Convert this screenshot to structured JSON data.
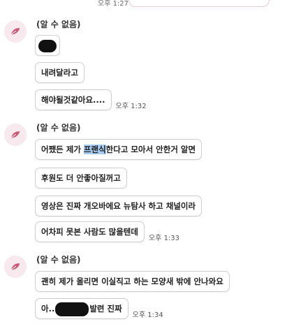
{
  "top": {
    "time": "오후 1:27"
  },
  "groups": [
    {
      "name": "(알 수 없음)",
      "messages": [
        {
          "text": "",
          "redacted": true
        },
        {
          "text": "내려달라고"
        },
        {
          "text": "해야될것같아요....",
          "time": "오후 1:32"
        }
      ]
    },
    {
      "name": "(알 수 없음)",
      "messages": [
        {
          "pre": "어쨌든 제가 ",
          "highlight": "프랜식",
          "post": "한다고 모아서 안한거 알면"
        },
        {
          "text": "후원도 더 안좋아질꺼고"
        },
        {
          "text": "영상은 진짜 개오바에요 뉴탐사 하고 채널이라"
        },
        {
          "text": "어차피 못본 사람도 많을텐데",
          "time": "오후 1:33"
        }
      ]
    },
    {
      "name": "(알 수 없음)",
      "messages": [
        {
          "text": "괜히 제가 올리면 이실직고 하는 모양새 밖에 안나와요"
        },
        {
          "pre": "아..",
          "post": "발련 진짜",
          "time": "오후 1:34"
        }
      ]
    }
  ]
}
